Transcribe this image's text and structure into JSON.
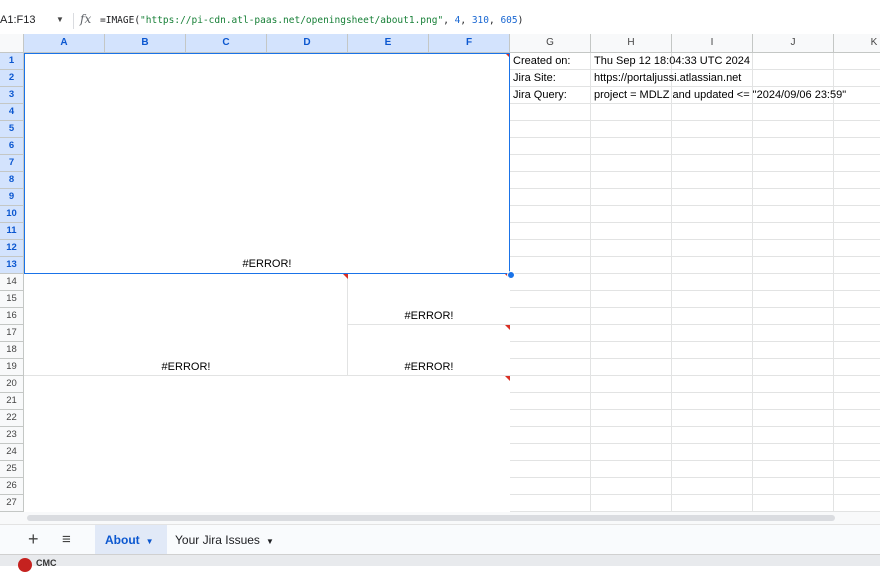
{
  "name_box": "A1:F13",
  "formula": {
    "fn_open": "=IMAGE(",
    "url": "\"https://pi-cdn.atl-paas.net/openingsheet/about1.png\"",
    "sep1": ", ",
    "a1": "4",
    "sep2": ", ",
    "a2": "310",
    "sep3": ", ",
    "a3": "605",
    "fn_close": ")"
  },
  "fx_label": "fx",
  "columns": [
    "A",
    "B",
    "C",
    "D",
    "E",
    "F",
    "G",
    "H",
    "I",
    "J",
    "K"
  ],
  "rows": [
    "1",
    "2",
    "3",
    "4",
    "5",
    "6",
    "7",
    "8",
    "9",
    "10",
    "11",
    "12",
    "13",
    "14",
    "15",
    "16",
    "17",
    "18",
    "19",
    "20",
    "21",
    "22",
    "23",
    "24",
    "25",
    "26",
    "27"
  ],
  "info": {
    "created_label": "Created on:",
    "created_value": "Thu Sep 12 18:04:33 UTC 2024",
    "site_label": "Jira Site:",
    "site_value": "https://portaljussi.atlassian.net",
    "query_label": "Jira Query:",
    "query_value": "project = MDLZ and updated <= \"2024/09/06 23:59\""
  },
  "errors": {
    "e1": "#ERROR!",
    "e2": "#ERROR!",
    "e3": "#ERROR!",
    "e4": "#ERROR!"
  },
  "tabs": {
    "add": "+",
    "all": "≡",
    "about": "About",
    "jira": "Your Jira Issues"
  },
  "taskbar_text": "CMC"
}
